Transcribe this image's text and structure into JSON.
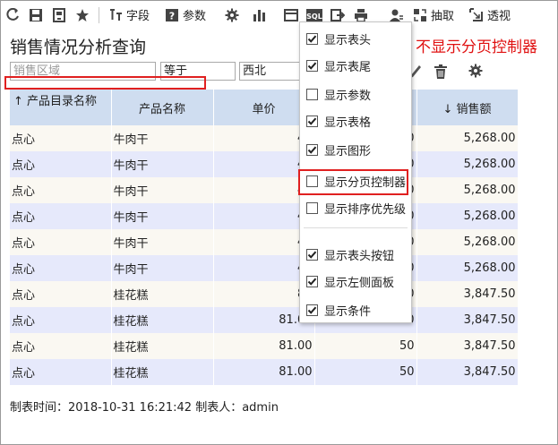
{
  "toolbar": {
    "field_label": "字段",
    "param_label": "参数",
    "extract_label": "抽取",
    "pivot_label": "透视",
    "sql_label": "SQL"
  },
  "title": "销售情况分析查询",
  "annotation": "不显示分页控制器",
  "condition": {
    "field_placeholder": "销售区域",
    "operator": "等于",
    "value": "西北"
  },
  "table": {
    "headers": [
      "↑ 产品目录名称",
      "产品名称",
      "单价",
      "",
      "↓ 销售额"
    ],
    "rows": [
      [
        "点心",
        "牛肉干",
        "43",
        "50",
        "5,268.00"
      ],
      [
        "点心",
        "牛肉干",
        "43",
        "50",
        "5,268.00"
      ],
      [
        "点心",
        "牛肉干",
        "43",
        "50",
        "5,268.00"
      ],
      [
        "点心",
        "牛肉干",
        "43",
        "50",
        "5,268.00"
      ],
      [
        "点心",
        "牛肉干",
        "43",
        "50",
        "5,268.00"
      ],
      [
        "点心",
        "牛肉干",
        "43",
        "50",
        "5,268.00"
      ],
      [
        "点心",
        "桂花糕",
        "81",
        "50",
        "3,847.50"
      ],
      [
        "点心",
        "桂花糕",
        "81.00",
        "50",
        "3,847.50"
      ],
      [
        "点心",
        "桂花糕",
        "81.00",
        "50",
        "3,847.50"
      ],
      [
        "点心",
        "桂花糕",
        "81.00",
        "50",
        "3,847.50"
      ]
    ]
  },
  "footer": "制表时间：2018-10-31 16:21:42 制表人：admin",
  "menu": {
    "items": [
      {
        "label": "显示表头",
        "checked": true
      },
      {
        "label": "显示表尾",
        "checked": true
      },
      {
        "label": "显示参数",
        "checked": false
      },
      {
        "label": "显示表格",
        "checked": true
      },
      {
        "label": "显示图形",
        "checked": true
      },
      {
        "label": "显示分页控制器",
        "checked": false
      },
      {
        "label": "显示排序优先级",
        "checked": false
      },
      {
        "label": "显示表头按钮",
        "checked": true
      },
      {
        "label": "显示左侧面板",
        "checked": true
      },
      {
        "label": "显示条件",
        "checked": true
      }
    ]
  },
  "colors": {
    "header_bg": "#cfddf0",
    "row_odd": "#faf8f2",
    "row_even": "#e6e9fb",
    "highlight_red": "#e02020",
    "icon_dark": "#444444"
  }
}
